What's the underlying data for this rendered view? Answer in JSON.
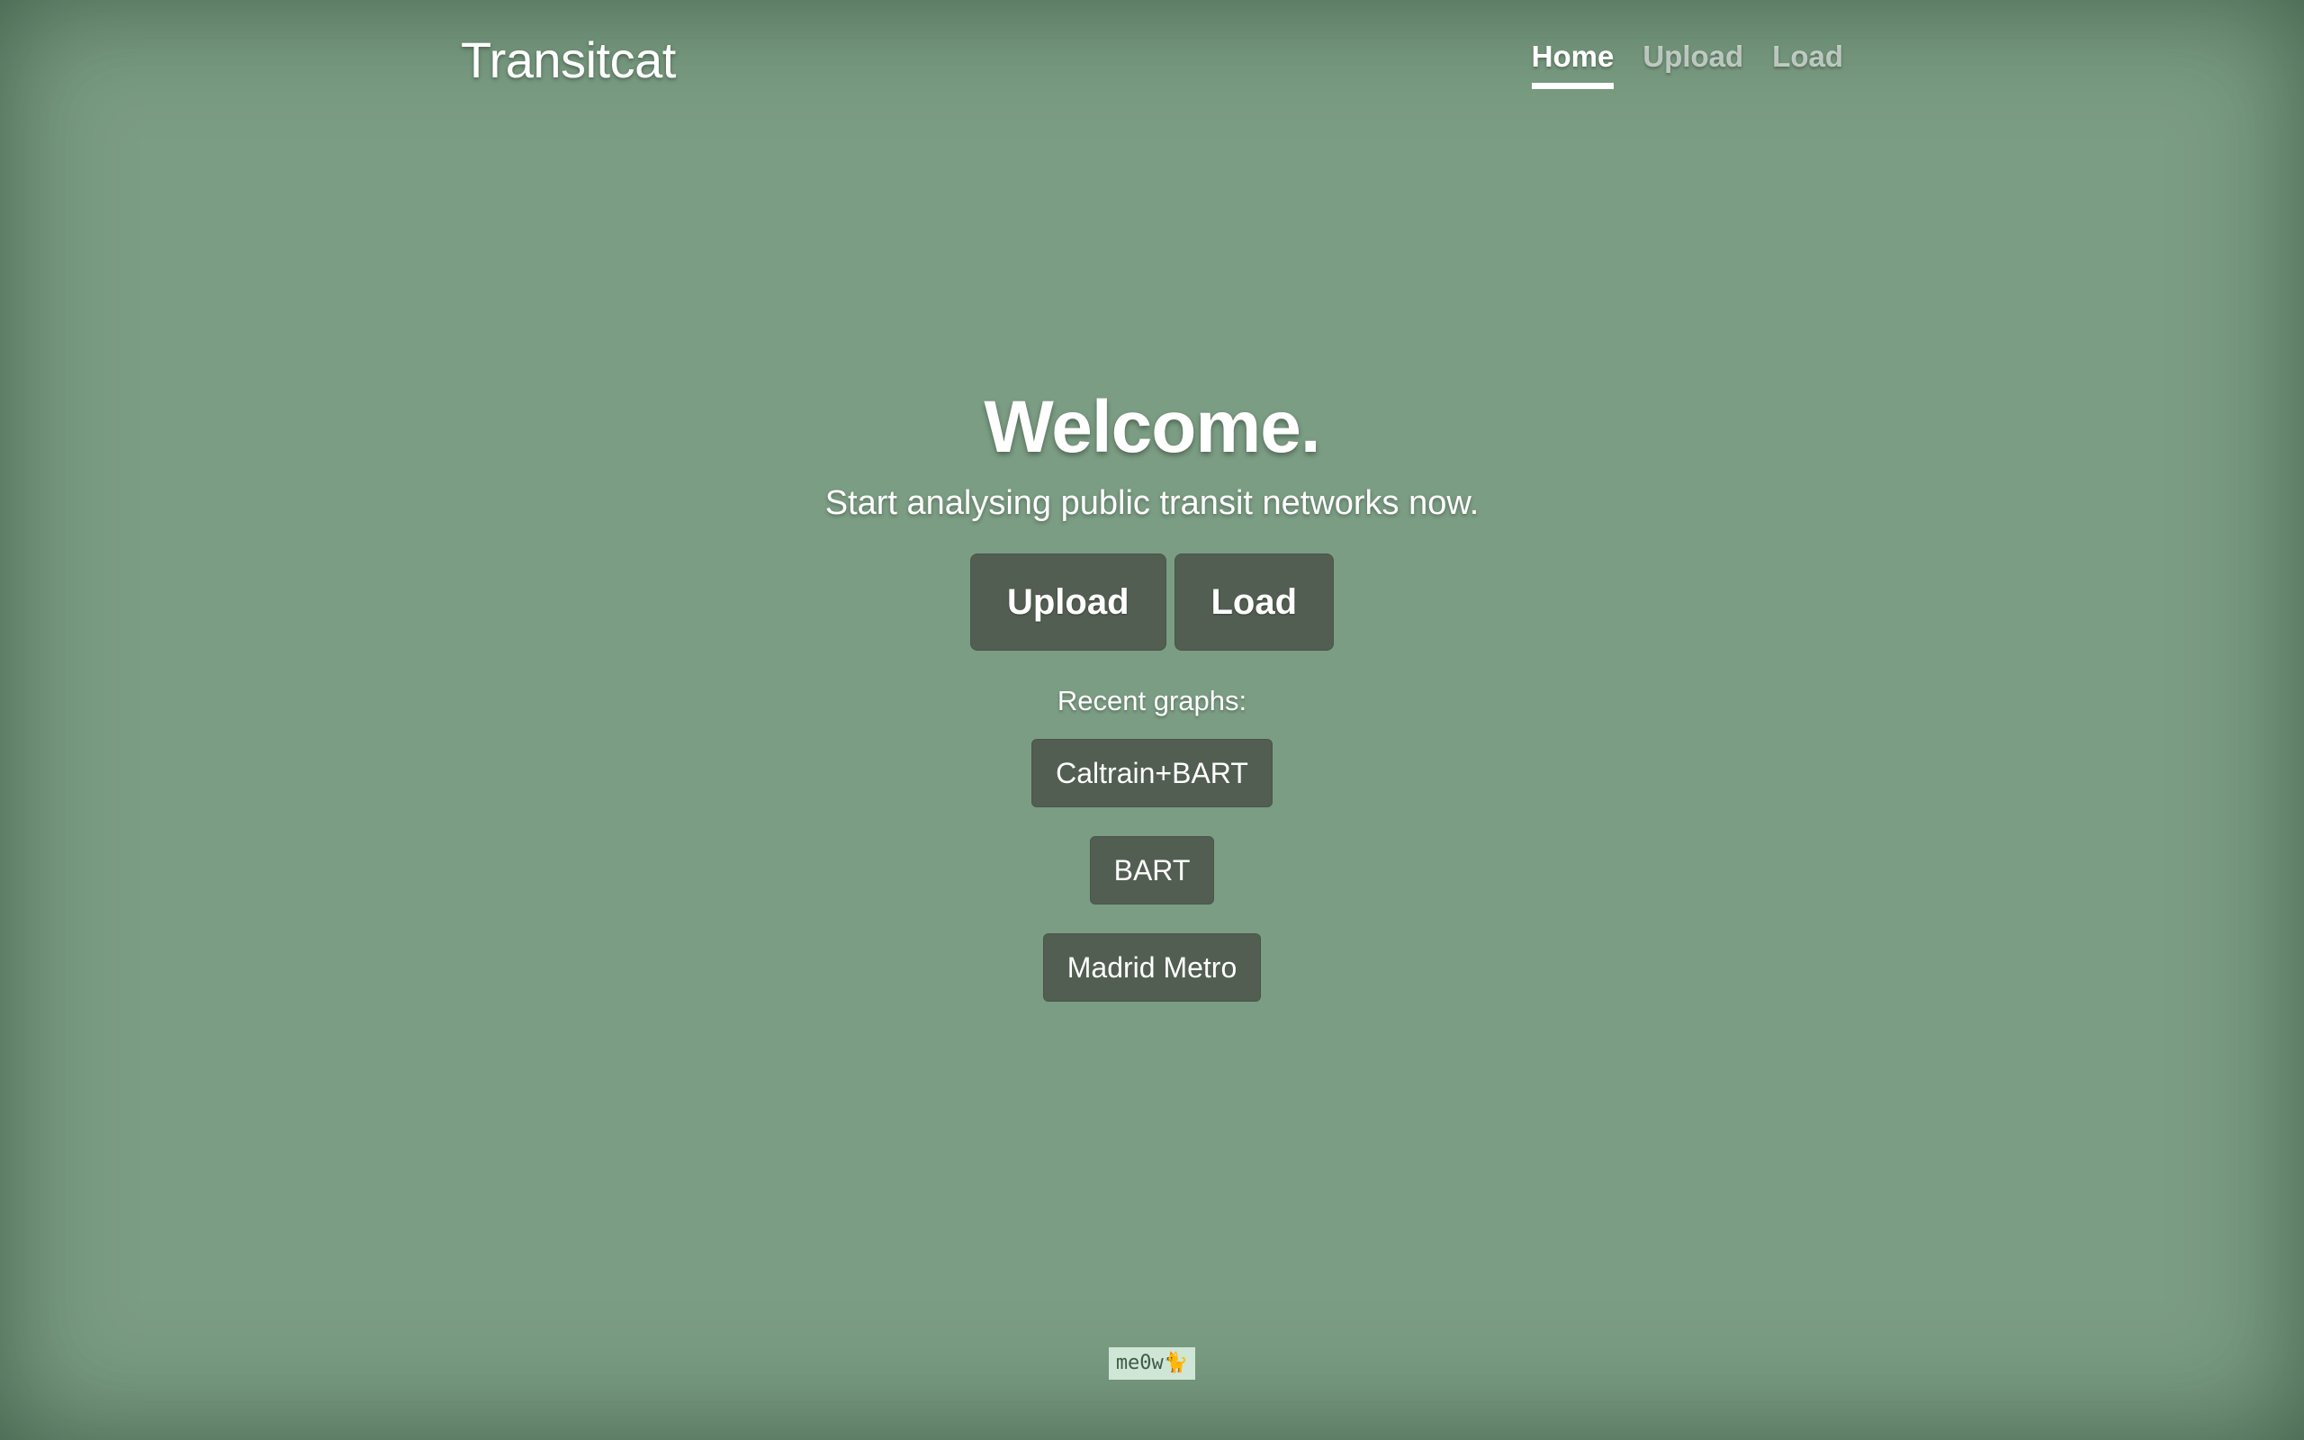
{
  "header": {
    "brand": "Transitcat",
    "nav": [
      {
        "label": "Home",
        "active": true
      },
      {
        "label": "Upload",
        "active": false
      },
      {
        "label": "Load",
        "active": false
      }
    ]
  },
  "hero": {
    "title": "Welcome.",
    "subtitle": "Start analysing public transit networks now.",
    "upload_label": "Upload",
    "load_label": "Load"
  },
  "recent": {
    "label": "Recent graphs:",
    "items": [
      "Caltrain+BART",
      "BART",
      "Madrid Metro"
    ]
  },
  "footer": {
    "badge": "me0w🐈"
  },
  "colors": {
    "background": "#7b9d83",
    "button": "#525e52",
    "text": "#ffffff",
    "footer_badge": "#cfe6d6"
  }
}
